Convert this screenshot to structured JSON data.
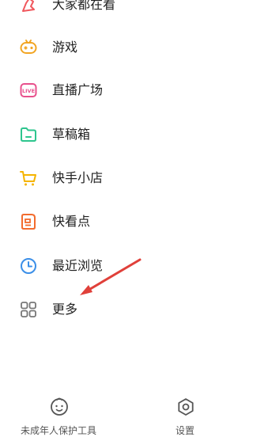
{
  "menu": {
    "items": [
      {
        "label": "大家都在看",
        "icon": "thumb-icon",
        "color": "#F0575D"
      },
      {
        "label": "游戏",
        "icon": "gamepad-icon",
        "color": "#F2A523"
      },
      {
        "label": "直播广场",
        "icon": "live-icon",
        "color": "#E8508C"
      },
      {
        "label": "草稿箱",
        "icon": "folder-icon",
        "color": "#2EC58E"
      },
      {
        "label": "快手小店",
        "icon": "cart-icon",
        "color": "#F5B400"
      },
      {
        "label": "快看点",
        "icon": "document-icon",
        "color": "#F26B2D"
      },
      {
        "label": "最近浏览",
        "icon": "clock-icon",
        "color": "#3B8FE8"
      },
      {
        "label": "更多",
        "icon": "grid-icon",
        "color": "#777777"
      }
    ]
  },
  "bottom": {
    "left_label": "未成年人保护工具",
    "right_label": "设置"
  },
  "annotation": {
    "arrow_color": "#E0403A"
  }
}
